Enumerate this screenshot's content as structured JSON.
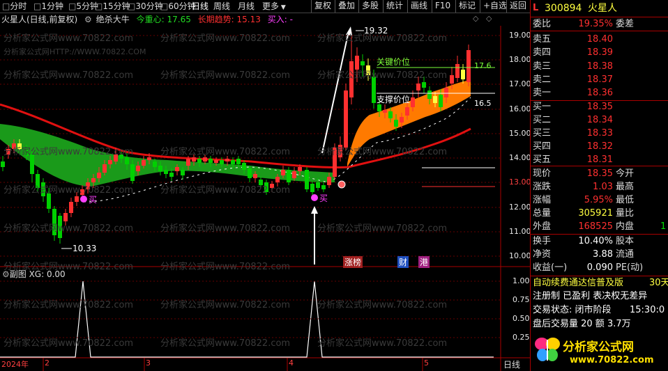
{
  "toolbar": {
    "items": [
      "分时",
      "1分钟",
      "5分钟",
      "15分钟",
      "30分钟",
      "60分钟",
      "日线",
      "周线",
      "月线",
      "更多"
    ],
    "right_items": [
      "复权",
      "叠加",
      "多股",
      "统计",
      "画线",
      "F10",
      "标记",
      "+自选",
      "返回"
    ]
  },
  "title": {
    "stock": "火星人(日线,前复权)",
    "indicator": "绝杀大牛",
    "core_label": "今重心: 17.65",
    "trend_label": "长期趋势: 15.13",
    "buy_label": "买入: -"
  },
  "watermark": {
    "line1": "分析家公式网www.70822.com",
    "line2": "分析家公式网HTTP://WWW.70822.COM"
  },
  "main_chart": {
    "price_axis": [
      "19.00",
      "18.00",
      "17.00",
      "16.00",
      "15.00",
      "14.00",
      "13.00",
      "12.00",
      "11.00",
      "10.00"
    ],
    "high_marker": "19.32",
    "low_marker": "10.33",
    "key_price_label": "关键价位",
    "support_label": "支撑价位",
    "key_price_value": "17.6",
    "support_value": "16.5",
    "buy_marker": "买",
    "tags": [
      "涨榜",
      "财",
      "港"
    ]
  },
  "sub_chart": {
    "title": "副图 XG: 0.00",
    "axis": [
      "1.00",
      "0.75",
      "0.50",
      "0.25"
    ]
  },
  "time_axis": {
    "labels": [
      "2024年",
      "2",
      "3",
      "4",
      "5"
    ],
    "period": "日线"
  },
  "panel": {
    "code": "300894",
    "name": "火星人",
    "logo_letter": "L",
    "ratio_label": "委比",
    "ratio_value": "19.35%",
    "ratio_right": "委差",
    "asks": [
      {
        "label": "卖五",
        "price": "18.40"
      },
      {
        "label": "卖四",
        "price": "18.39"
      },
      {
        "label": "卖三",
        "price": "18.38"
      },
      {
        "label": "卖二",
        "price": "18.37"
      },
      {
        "label": "卖一",
        "price": "18.36"
      }
    ],
    "bids": [
      {
        "label": "买一",
        "price": "18.35"
      },
      {
        "label": "买二",
        "price": "18.34"
      },
      {
        "label": "买三",
        "price": "18.33"
      },
      {
        "label": "买四",
        "price": "18.32"
      },
      {
        "label": "买五",
        "price": "18.31"
      }
    ],
    "stats": [
      {
        "label": "现价",
        "value": "18.35",
        "right": "今开",
        "color": "red"
      },
      {
        "label": "涨跌",
        "value": "1.03",
        "right": "最高",
        "color": "red"
      },
      {
        "label": "涨幅",
        "value": "5.95%",
        "right": "最低",
        "color": "red"
      },
      {
        "label": "总量",
        "value": "305921",
        "right": "量比",
        "color": "yellow"
      },
      {
        "label": "外盘",
        "value": "168525",
        "right": "内盘",
        "color": "red"
      }
    ],
    "stats2": [
      {
        "label": "换手",
        "value": "10.40%",
        "right": "股本",
        "color": "white"
      },
      {
        "label": "净资",
        "value": "3.88",
        "right": "流通",
        "color": "white"
      },
      {
        "label": "收益(一)",
        "value": "0.090",
        "right": "PE(动)",
        "color": "white"
      }
    ],
    "news1": "自动续费通达信普及版",
    "news1_right": "30天",
    "news2": "注册制 已盈利 表决权无差异",
    "trade_state": "交易状态: 闭市阶段",
    "trade_time": "15:30:0",
    "after_volume": "盘后交易量 20 额 3.7万",
    "outer_small": "1",
    "logo_text": "分析家公式网",
    "logo_url": "www.70822.com"
  },
  "colors": {
    "up": "#ff3030",
    "down": "#00d000",
    "trend_line": "#e01010",
    "band_green": "#1a9a1a",
    "band_orange": "#ff7a00"
  }
}
